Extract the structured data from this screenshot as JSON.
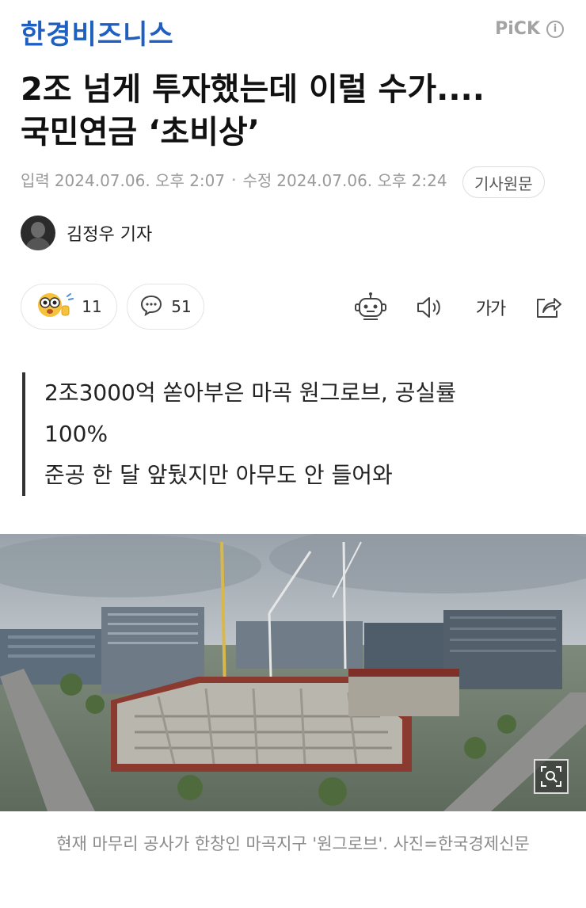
{
  "header": {
    "brand": "한경비즈니스",
    "pick_label": "PiCK",
    "info_glyph": "i"
  },
  "article": {
    "title_line1": "2조 넘게 투자했는데 이럴 수가....",
    "title_line2": "국민연금 ‘초비상’",
    "input_label": "입력",
    "input_time": "2024.07.06. 오후 2:07",
    "separator": "·",
    "edit_label": "수정",
    "edit_time": "2024.07.06. 오후 2:24",
    "original_button": "기사원문",
    "author": "김정우 기자"
  },
  "reactions": {
    "emoji_count": "11",
    "comment_count": "51"
  },
  "toolbar": {
    "font_size_label": "가가"
  },
  "summary": {
    "line1": "2조3000억 쏟아부은 마곡 원그로브, 공실률",
    "line2": "100%",
    "line3": "준공 한 달 앞뒀지만 아무도 안 들어와"
  },
  "photo": {
    "caption": "현재 마무리 공사가 한창인 마곡지구 '원그로브'. 사진=한국경제신문"
  },
  "colors": {
    "brand": "#1f5fbf",
    "meta_gray": "#9a9a9a",
    "summary_bar": "#333333"
  },
  "icons": [
    "info-icon",
    "emoji-reaction-icon",
    "comment-icon",
    "robot-summary-icon",
    "speaker-icon",
    "font-size-icon",
    "share-icon",
    "zoom-icon"
  ]
}
